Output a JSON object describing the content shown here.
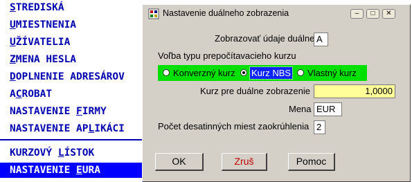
{
  "menu": {
    "items": [
      {
        "pre": "",
        "hot": "S",
        "post": "TREDISKÁ"
      },
      {
        "pre": "",
        "hot": "U",
        "post": "MIESTNENIA"
      },
      {
        "pre": "",
        "hot": "U",
        "post": "ŽÍVATELIA"
      },
      {
        "pre": "",
        "hot": "Z",
        "post": "MENA HESLA"
      },
      {
        "pre": "",
        "hot": "D",
        "post": "OPLNENIE ADRESÁROV"
      },
      {
        "pre": "A",
        "hot": "C",
        "post": "ROBAT"
      },
      {
        "pre": "NASTAVENIE ",
        "hot": "F",
        "post": "IRMY"
      },
      {
        "pre": "NASTAVENIE AP",
        "hot": "L",
        "post": "IKÁCI"
      },
      {
        "pre": "KURZOVÝ ",
        "hot": "L",
        "post": "ÍSTOK"
      },
      {
        "pre": "NASTAVENIE ",
        "hot": "E",
        "post": "URA"
      }
    ],
    "highlight_color": "#0000ff",
    "text_color": "#0000b0"
  },
  "dialog": {
    "title": "Nastavenie duálneho zobrazenia",
    "window_buttons": {
      "minimize": "–",
      "maximize": "□",
      "close": "✕"
    },
    "show_dual_label": "Zobrazovať údaje duálne",
    "show_dual_value": "A",
    "rate_choice_label": "Voľba typu prepočítavacieho kurzu",
    "radios": [
      {
        "label": "Konverzný kurz",
        "selected": false
      },
      {
        "label": "Kurz NBS",
        "selected": true
      },
      {
        "label": "Vlastný kurz",
        "selected": false
      }
    ],
    "rate_label": "Kurz pre duálne zobrazenie",
    "rate_value": "1,0000",
    "currency_label": "Mena",
    "currency_value": "EUR",
    "decimals_label": "Počet desatinných miest zaokrúhlenia",
    "decimals_value": "2",
    "ok_label": "OK",
    "cancel_label": "Zruš",
    "help_label": "Pomoc",
    "colors": {
      "radio_group_bg": "#00e000",
      "rate_field_bg": "#ffff99",
      "cancel_text": "#c00000"
    }
  }
}
